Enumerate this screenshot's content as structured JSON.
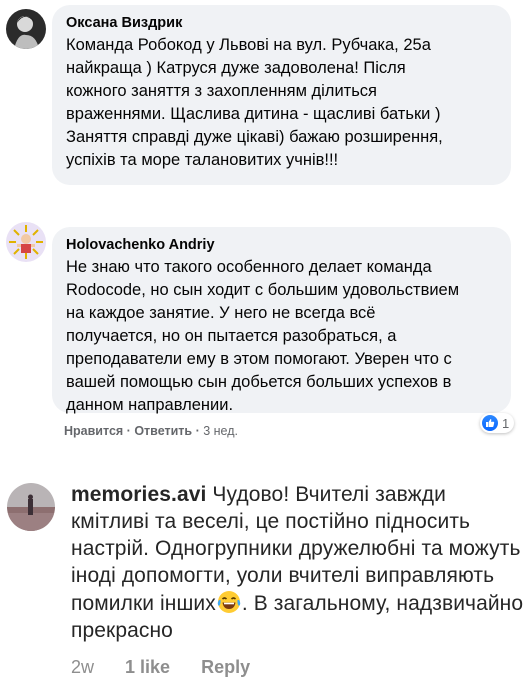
{
  "comments": [
    {
      "author": "Оксана Виздрик",
      "text": "Команда Робокод у Львові на вул. Рубчака, 25а\nнайкраща ) Катруся дуже задоволена! Після\nкожного заняття з захопленням ділиться\nвраженнями. Щаслива дитина - щасливі батьки )\nЗаняття справді дуже цікаві) бажаю розширення,\nуспіхів та море талановитих учнів!!!"
    },
    {
      "author": "Holovachenko Andriy",
      "text": "Не знаю что такого особенного делает команда\nRodocode, но сын ходит с большим удовольствием\nна каждое занятие. У него не всегда всё\nполучается, но он пытается разобраться, а\nпреподаватели ему в этом помогают. Уверен что с\nвашей помощью сын добьется больших успехов в\nданном направлении.",
      "like_label": "Нравится",
      "separator": "·",
      "reply_label": "Ответить",
      "time": "3 нед.",
      "reaction_count": "1",
      "colors": {
        "like_blue": "#0866ff"
      }
    }
  ],
  "instagram_comment": {
    "username": "memories.avi",
    "text_before_emoji": "Чудово! Вчителі завжди кмітливі та веселі, це постійно підносить настрій. Одногрупники дружелюбні та можуть іноді допомогти, уоли вчителі виправляють помилки інших",
    "emoji": "laughing-with-tears-emoji",
    "text_after_emoji": ". В загальному, надзвичайно прекрасно",
    "time": "2w",
    "likes": "1 like",
    "reply_label": "Reply"
  }
}
